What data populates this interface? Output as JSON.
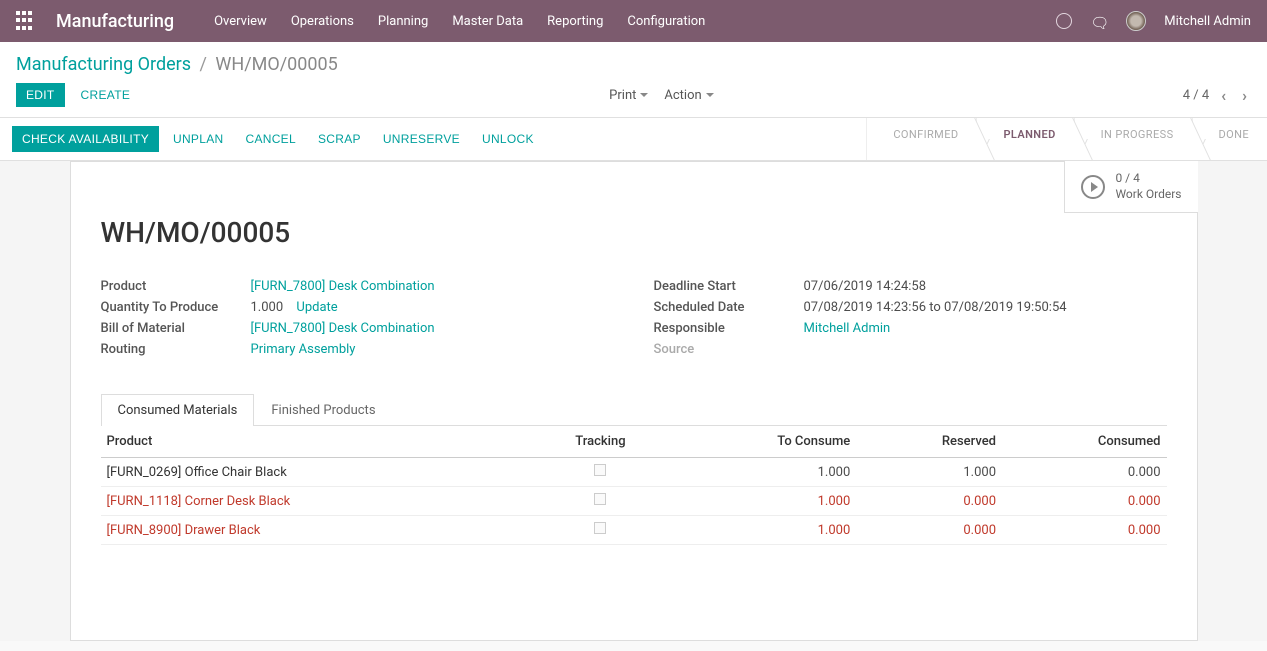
{
  "topnav": {
    "brand": "Manufacturing",
    "menu": [
      "Overview",
      "Operations",
      "Planning",
      "Master Data",
      "Reporting",
      "Configuration"
    ],
    "user": "Mitchell Admin"
  },
  "breadcrumb": {
    "root": "Manufacturing Orders",
    "leaf": "WH/MO/00005"
  },
  "buttons": {
    "edit": "EDIT",
    "create": "CREATE"
  },
  "dropdowns": {
    "print": "Print",
    "action": "Action"
  },
  "pager": {
    "text": "4 / 4"
  },
  "actions": {
    "check": "CHECK AVAILABILITY",
    "list": [
      "UNPLAN",
      "CANCEL",
      "SCRAP",
      "UNRESERVE",
      "UNLOCK"
    ]
  },
  "status": {
    "steps": [
      {
        "label": "CONFIRMED",
        "active": false
      },
      {
        "label": "PLANNED",
        "active": true
      },
      {
        "label": "IN PROGRESS",
        "active": false
      },
      {
        "label": "DONE",
        "active": false
      }
    ]
  },
  "stat": {
    "count": "0 / 4",
    "label": "Work Orders"
  },
  "record": {
    "title": "WH/MO/00005",
    "left": {
      "product_label": "Product",
      "product_value": "[FURN_7800] Desk Combination",
      "qty_label": "Quantity To Produce",
      "qty_value": "1.000",
      "update": "Update",
      "bom_label": "Bill of Material",
      "bom_value": "[FURN_7800] Desk Combination",
      "routing_label": "Routing",
      "routing_value": "Primary Assembly"
    },
    "right": {
      "deadline_label": "Deadline Start",
      "deadline_value": "07/06/2019 14:24:58",
      "sched_label": "Scheduled Date",
      "sched_value": "07/08/2019 14:23:56 to 07/08/2019 19:50:54",
      "resp_label": "Responsible",
      "resp_value": "Mitchell Admin",
      "source_label": "Source"
    }
  },
  "tabs": {
    "consumed": "Consumed Materials",
    "finished": "Finished Products"
  },
  "table": {
    "headers": {
      "product": "Product",
      "tracking": "Tracking",
      "to_consume": "To Consume",
      "reserved": "Reserved",
      "consumed": "Consumed"
    },
    "rows": [
      {
        "product": "[FURN_0269] Office Chair Black",
        "to_consume": "1.000",
        "reserved": "1.000",
        "consumed": "0.000",
        "warn": false
      },
      {
        "product": "[FURN_1118] Corner Desk Black",
        "to_consume": "1.000",
        "reserved": "0.000",
        "consumed": "0.000",
        "warn": true
      },
      {
        "product": "[FURN_8900] Drawer Black",
        "to_consume": "1.000",
        "reserved": "0.000",
        "consumed": "0.000",
        "warn": true
      }
    ]
  }
}
